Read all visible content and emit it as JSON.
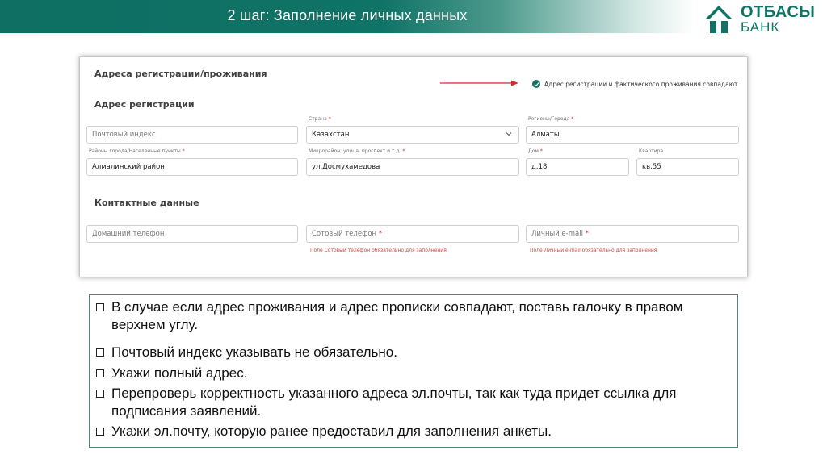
{
  "header": {
    "title": "2 шаг: Заполнение личных данных"
  },
  "logo": {
    "line1": "ОТБАСЫ",
    "line2": "БАНК",
    "brand_color": "#0f7366"
  },
  "form": {
    "section_title": "Адреса регистрации/проживания",
    "checkbox_label": "Адрес регистрации и фактического проживания совпадают",
    "checkbox_checked": true,
    "registration_title": "Адрес регистрации",
    "fields": {
      "postal_index": {
        "placeholder": "Почтовый индекс"
      },
      "country": {
        "label": "Страна",
        "value": "Казахстан"
      },
      "region": {
        "label": "Регионы/Города",
        "value": "Алматы"
      },
      "district": {
        "label": "Районы города/Населенные пункты",
        "value": "Алмалинский район"
      },
      "street": {
        "label": "Микрорайон, улица, проспект и т.д.",
        "value": "ул.Досмухамедова"
      },
      "house": {
        "label": "Дом",
        "value": "д.18"
      },
      "apartment": {
        "label": "Квартира",
        "value": "кв.55"
      }
    },
    "contacts_title": "Контактные данные",
    "contacts": {
      "home_phone": {
        "placeholder": "Домашний телефон"
      },
      "mobile_phone": {
        "placeholder": "Сотовый телефон",
        "error": "Поле Сотовый телефон обязательно для заполнения"
      },
      "email": {
        "placeholder": "Личный e-mail",
        "error": "Поле Личный e-mail обязательно для заполнения"
      }
    },
    "required_mark": "*",
    "accent_color": "#17705f",
    "error_color": "#d9423a"
  },
  "instructions": [
    "В случае если адрес проживания и адрес прописки совпадают, поставь галочку в правом верхнем углу.",
    "Почтовый индекс указывать не обязательно.",
    "Укажи полный адрес.",
    "Перепроверь корректность указанного адреса эл.почты, так как туда придет ссылка для подписания заявлений.",
    "Укажи эл.почту, которую ранее предоставил для заполнения анкеты."
  ]
}
